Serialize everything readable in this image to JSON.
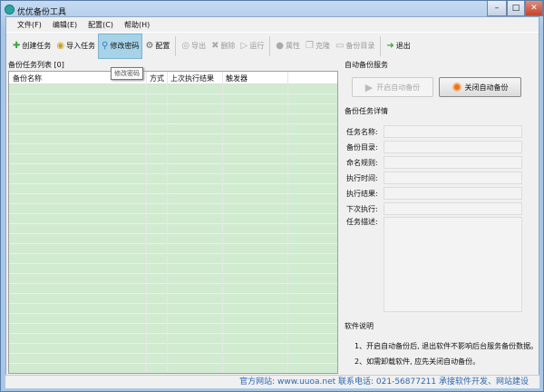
{
  "window": {
    "title": "优优备份工具",
    "minimize": "–",
    "maximize": "□",
    "close": "✕"
  },
  "menu": [
    "文件(F)",
    "编辑(E)",
    "配置(C)",
    "帮助(H)"
  ],
  "toolbar": [
    {
      "label": "创建任务",
      "icon": "plus-icon",
      "glyph": "✚",
      "color": "#3aa53a",
      "enabled": true
    },
    {
      "label": "导入任务",
      "icon": "import-icon",
      "glyph": "◉",
      "color": "#c9a020",
      "enabled": true
    },
    {
      "label": "修改密码",
      "icon": "key-icon",
      "glyph": "⚲",
      "color": "#3b7ac0",
      "enabled": true,
      "hover": true
    },
    {
      "label": "配置",
      "icon": "gear-icon",
      "glyph": "⚙",
      "color": "#666",
      "enabled": true
    },
    {
      "label": "导出",
      "icon": "export-icon",
      "glyph": "◎",
      "color": "#aaa",
      "enabled": false
    },
    {
      "label": "删除",
      "icon": "delete-icon",
      "glyph": "✖",
      "color": "#aaa",
      "enabled": false
    },
    {
      "label": "运行",
      "icon": "run-icon",
      "glyph": "▷",
      "color": "#aaa",
      "enabled": false
    },
    {
      "label": "属性",
      "icon": "properties-icon",
      "glyph": "●",
      "color": "#aaa",
      "enabled": false
    },
    {
      "label": "克隆",
      "icon": "clone-icon",
      "glyph": "❐",
      "color": "#aaa",
      "enabled": false
    },
    {
      "label": "备份目录",
      "icon": "folder-icon",
      "glyph": "▭",
      "color": "#aaa",
      "enabled": false
    },
    {
      "label": "退出",
      "icon": "exit-icon",
      "glyph": "➜",
      "color": "#3aa53a",
      "enabled": true
    }
  ],
  "tooltip": "修改密码",
  "list": {
    "title": "备份任务列表 [0]",
    "columns": [
      "备份名称",
      "方式",
      "上次执行结果",
      "触发器"
    ]
  },
  "service": {
    "title": "自动备份服务",
    "start": "开启自动备份",
    "stop": "关闭自动备份"
  },
  "details": {
    "title": "备份任务详情",
    "fields": [
      "任务名称:",
      "备份目录:",
      "命名规则:",
      "执行时间:",
      "执行结果:",
      "下次执行:"
    ],
    "desc": "任务描述:"
  },
  "notes": {
    "title": "软件说明",
    "lines": [
      "1、开启自动备份后, 退出软件不影响后台服务备份数据。",
      "2、如需卸载软件, 应先关闭自动备份。"
    ]
  },
  "status": "官方网站: www.uuoa.net 联系电话: 021-56877211 承接软件开发、网站建设"
}
